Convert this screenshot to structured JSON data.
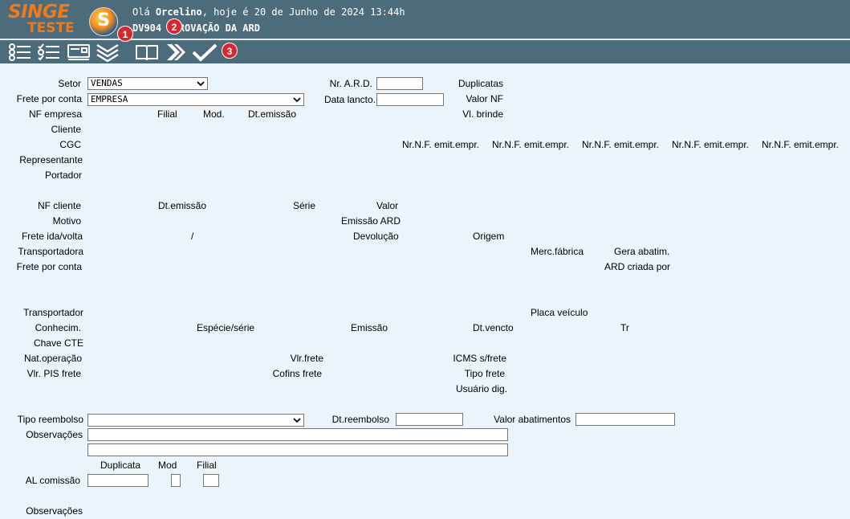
{
  "header": {
    "logo_line1": "SINGE",
    "logo_line2": "TESTE",
    "logo_orb_letter": "S",
    "greeting_prefix": "Olá ",
    "user_name": "Orcelino",
    "greeting_suffix": ", hoje é 20 de Junho de 2024 13:44h",
    "program_code": "DV904",
    "program_title": "APROVAÇÃO DA ARD"
  },
  "toolbar": {
    "icons": [
      "list-icon",
      "checklist-icon",
      "card-icon",
      "expand-all-icon",
      "book-icon",
      "next-icon",
      "check-icon"
    ],
    "badges": [
      "1",
      "2",
      "3"
    ]
  },
  "form": {
    "setor_label": "Setor",
    "setor_value": "VENDAS",
    "frete_por_conta_label": "Frete por conta",
    "frete_por_conta_value": "EMPRESA",
    "nf_empresa_label": "NF empresa",
    "filial_label": "Filial",
    "mod_label": "Mod.",
    "dt_emissao_label": "Dt.emissão",
    "cliente_label": "Cliente",
    "cgc_label": "CGC",
    "representante_label": "Representante",
    "portador_label": "Portador",
    "nr_ard_label": "Nr. A.R.D.",
    "nr_ard_value": "",
    "data_lancto_label": "Data lancto.",
    "data_lancto_value": "",
    "duplicatas_label": "Duplicatas",
    "valor_nf_label": "Valor NF",
    "vl_brinde_label": "Vl. brinde",
    "nr_nf_emit_headers": [
      "Nr.N.F. emit.empr.",
      "Nr.N.F. emit.empr.",
      "Nr.N.F. emit.empr.",
      "Nr.N.F. emit.empr.",
      "Nr.N.F. emit.empr."
    ],
    "nf_cliente_label": "NF cliente",
    "dt_emissao2_label": "Dt.emissão",
    "serie_label": "Série",
    "valor_label": "Valor",
    "motivo_label": "Motivo",
    "emissao_ard_label": "Emissão ARD",
    "frete_ida_volta_label": "Frete ida/volta",
    "slash": "/",
    "devolucao_label": "Devolução",
    "origem_label": "Origem",
    "transportadora_label": "Transportadora",
    "merc_fabrica_label": "Merc.fábrica",
    "gera_abatim_label": "Gera abatim.",
    "frete_por_conta2_label": "Frete por conta",
    "ard_criada_por_label": "ARD criada por",
    "transportador_label": "Transportador",
    "placa_veiculo_label": "Placa veículo",
    "conhecim_label": "Conhecim.",
    "especie_serie_label": "Espécie/série",
    "emissao_label": "Emissão",
    "dt_vencto_label": "Dt.vencto",
    "tr_label": "Tr",
    "chave_cte_label": "Chave CTE",
    "nat_operacao_label": "Nat.operação",
    "vlr_frete_label": "Vlr.frete",
    "icms_s_frete_label": "ICMS s/frete",
    "vlr_pis_frete_label": "Vlr. PIS frete",
    "cofins_frete_label": "Cofins frete",
    "tipo_frete_label": "Tipo frete",
    "usuario_dig_label": "Usuário dig.",
    "tipo_reembolso_label": "Tipo reembolso",
    "tipo_reembolso_value": "",
    "dt_reembolso_label": "Dt.reembolso",
    "valor_abatimentos_label": "Valor abatimentos",
    "observacoes_label": "Observações",
    "duplicata_label": "Duplicata",
    "mod2_label": "Mod",
    "filial2_label": "Filial",
    "al_comissao_label": "AL comissão",
    "observacoes2_label": "Observações"
  }
}
